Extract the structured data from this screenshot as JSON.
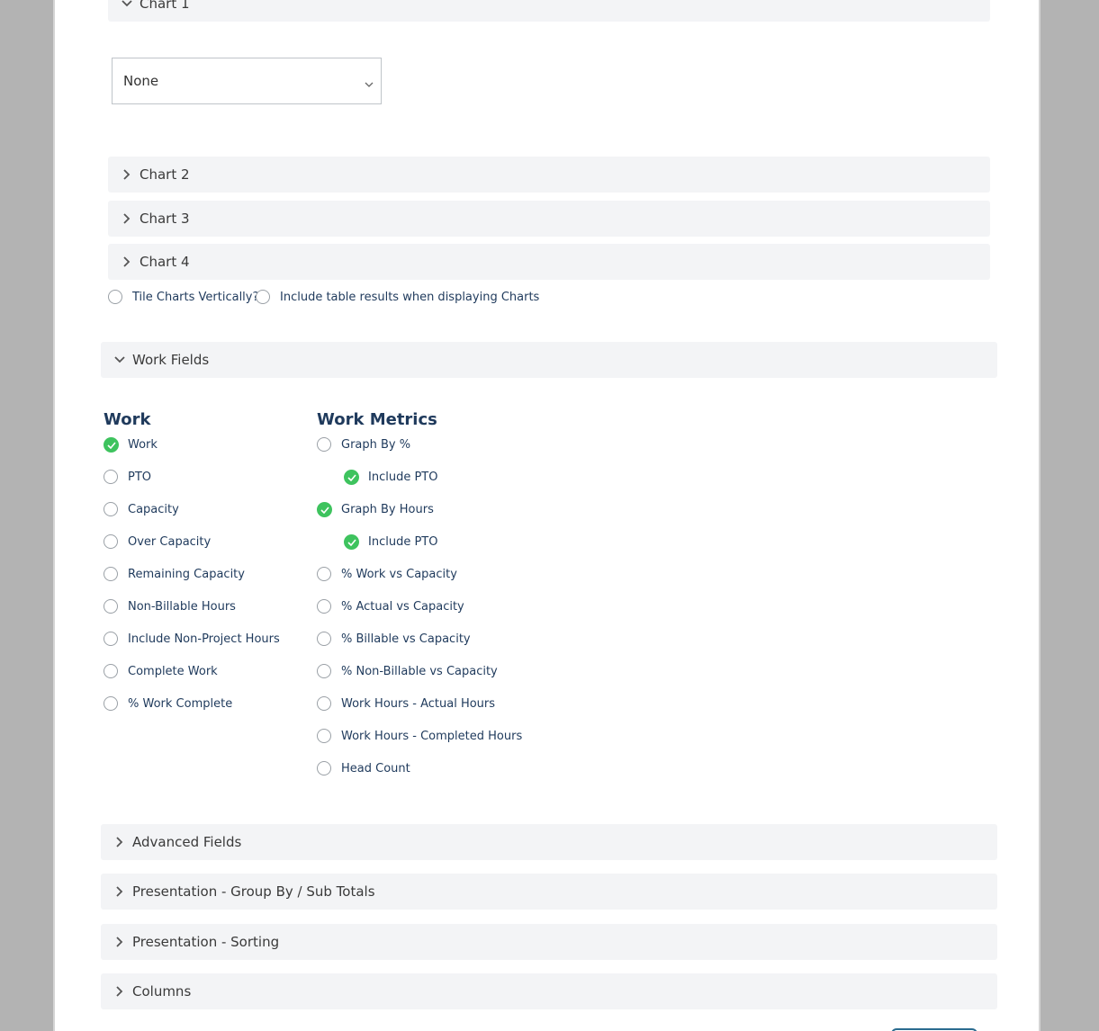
{
  "charts": {
    "chart1": {
      "label": "Chart 1",
      "select_value": "None"
    },
    "chart2": {
      "label": "Chart 2"
    },
    "chart3": {
      "label": "Chart 3"
    },
    "chart4": {
      "label": "Chart 4"
    },
    "tile_vertically_label": "Tile Charts Vertically?",
    "include_table_label": "Include table results when displaying Charts"
  },
  "work_fields": {
    "label": "Work Fields",
    "work": {
      "heading": "Work",
      "items": [
        {
          "label": "Work",
          "checked": true
        },
        {
          "label": "PTO",
          "checked": false
        },
        {
          "label": "Capacity",
          "checked": false
        },
        {
          "label": "Over Capacity",
          "checked": false
        },
        {
          "label": "Remaining Capacity",
          "checked": false
        },
        {
          "label": "Non-Billable Hours",
          "checked": false
        },
        {
          "label": "Include Non-Project Hours",
          "checked": false
        },
        {
          "label": "Complete Work",
          "checked": false
        },
        {
          "label": "% Work Complete",
          "checked": false
        }
      ]
    },
    "metrics": {
      "heading": "Work Metrics",
      "items": [
        {
          "label": "Graph By %",
          "checked": false
        },
        {
          "label": "Include PTO",
          "checked": true
        },
        {
          "label": "Graph By Hours",
          "checked": true
        },
        {
          "label": "Include PTO",
          "checked": true
        },
        {
          "label": "% Work vs Capacity",
          "checked": false
        },
        {
          "label": "% Actual vs Capacity",
          "checked": false
        },
        {
          "label": "% Billable vs Capacity",
          "checked": false
        },
        {
          "label": "% Non-Billable vs Capacity",
          "checked": false
        },
        {
          "label": "Work Hours - Actual Hours",
          "checked": false
        },
        {
          "label": "Work Hours - Completed Hours",
          "checked": false
        },
        {
          "label": "Head Count",
          "checked": false
        }
      ]
    }
  },
  "sections": {
    "advanced": "Advanced Fields",
    "group_by": "Presentation - Group By / Sub Totals",
    "sorting": "Presentation - Sorting",
    "columns": "Columns"
  },
  "colors": {
    "accent_text": "#1f3a5c",
    "check_green": "#3ec35e",
    "header_bg": "#f3f4f6"
  }
}
